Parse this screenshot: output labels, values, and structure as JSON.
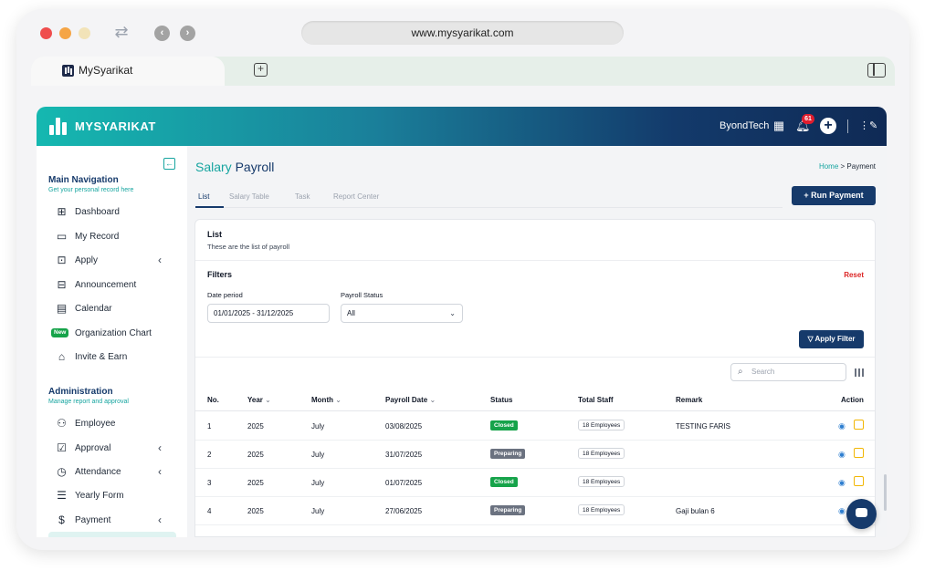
{
  "browser": {
    "url": "www.mysyarikat.com",
    "tab_title": "MySyarikat"
  },
  "appbar": {
    "brand": "MYSYARIKAT",
    "org_name": "ByondTech",
    "notification_count": "61"
  },
  "sidebar": {
    "main_title": "Main Navigation",
    "main_subtitle": "Get your personal record here",
    "main_items": [
      {
        "label": "Dashboard",
        "icon": "grid-icon"
      },
      {
        "label": "My Record",
        "icon": "folder-icon"
      },
      {
        "label": "Apply",
        "icon": "apply-icon",
        "expandable": true
      },
      {
        "label": "Announcement",
        "icon": "announcement-icon"
      },
      {
        "label": "Calendar",
        "icon": "calendar-icon"
      },
      {
        "label": "Organization Chart",
        "icon": "new-badge",
        "badge": "New"
      },
      {
        "label": "Invite & Earn",
        "icon": "gift-icon"
      }
    ],
    "admin_title": "Administration",
    "admin_subtitle": "Manage report and approval",
    "admin_items": [
      {
        "label": "Employee",
        "icon": "users-icon"
      },
      {
        "label": "Approval",
        "icon": "check-square-icon",
        "expandable": true
      },
      {
        "label": "Attendance",
        "icon": "clock-icon",
        "expandable": true
      },
      {
        "label": "Yearly Form",
        "icon": "form-icon"
      },
      {
        "label": "Payment",
        "icon": "dollar-icon",
        "expandable": true
      }
    ]
  },
  "page": {
    "title_part1": "Salary ",
    "title_part2": "Payroll",
    "breadcrumb_home": "Home",
    "breadcrumb_sep": ">",
    "breadcrumb_current": "Payment",
    "tabs": [
      "List",
      "Salary Table",
      "Task",
      "Report Center"
    ],
    "run_payment": "+ Run Payment"
  },
  "card": {
    "title": "List",
    "subtitle": "These are the list of payroll",
    "filters_title": "Filters",
    "reset": "Reset",
    "date_label": "Date period",
    "date_value": "01/01/2025 - 31/12/2025",
    "status_label": "Payroll Status",
    "status_value": "All",
    "apply_filter": "Apply Filter",
    "search_placeholder": "Search"
  },
  "table": {
    "headers": [
      "No.",
      "Year",
      "Month",
      "Payroll Date",
      "Status",
      "Total Staff",
      "Remark",
      "Action"
    ],
    "rows": [
      {
        "no": "1",
        "year": "2025",
        "month": "July",
        "date": "03/08/2025",
        "status": "Closed",
        "staff": "18 Employees",
        "remark": "TESTING FARIS"
      },
      {
        "no": "2",
        "year": "2025",
        "month": "July",
        "date": "31/07/2025",
        "status": "Preparing",
        "staff": "18 Employees",
        "remark": ""
      },
      {
        "no": "3",
        "year": "2025",
        "month": "July",
        "date": "01/07/2025",
        "status": "Closed",
        "staff": "18 Employees",
        "remark": ""
      },
      {
        "no": "4",
        "year": "2025",
        "month": "July",
        "date": "27/06/2025",
        "status": "Preparing",
        "staff": "18 Employees",
        "remark": "Gaji bulan 6"
      }
    ]
  },
  "colors": {
    "primary": "#163a6b",
    "accent": "#17a5a0",
    "closed": "#16a34a",
    "preparing": "#6b7280",
    "danger": "#dc2626"
  }
}
